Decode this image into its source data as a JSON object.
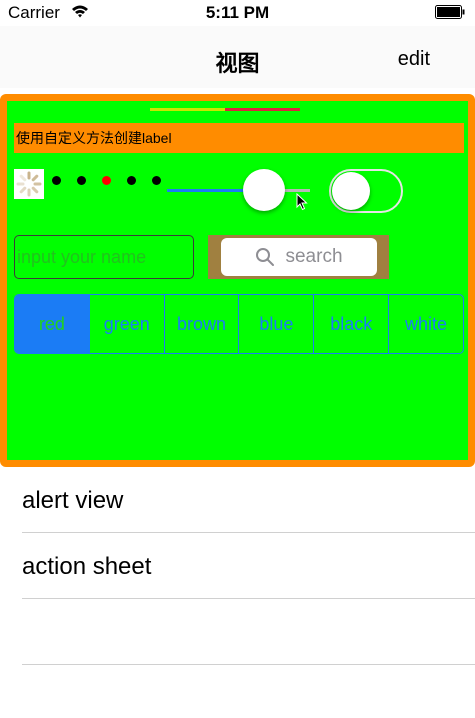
{
  "status_bar": {
    "carrier": "Carrier",
    "time": "5:11 PM"
  },
  "nav": {
    "title": "视图",
    "edit_label": "edit"
  },
  "demo": {
    "progress_value": 0.5,
    "label_text": "使用自定义方法创建label",
    "page_control": {
      "count": 5,
      "current_index": 2
    },
    "slider_value": 0.68,
    "switch_on": false,
    "text_field_placeholder": "input your name",
    "search_placeholder": "search",
    "segments": [
      "red",
      "green",
      "brown",
      "blue",
      "black",
      "white"
    ],
    "selected_segment": 0
  },
  "table": {
    "rows": [
      {
        "label": "alert view"
      },
      {
        "label": "action sheet"
      },
      {
        "label": ""
      }
    ]
  },
  "icons": {
    "wifi": "wifi-icon",
    "battery": "battery-icon",
    "activity": "activity-indicator-icon",
    "search": "search-icon",
    "cursor": "cursor-icon"
  },
  "colors": {
    "panel": "#ff8c00",
    "content": "#00ff00",
    "accent": "#1b7cf5",
    "progress_start": "#c8e600",
    "progress_end": "#d8273c",
    "page_dot_active": "#ff0000",
    "search_bg": "#a08040"
  }
}
